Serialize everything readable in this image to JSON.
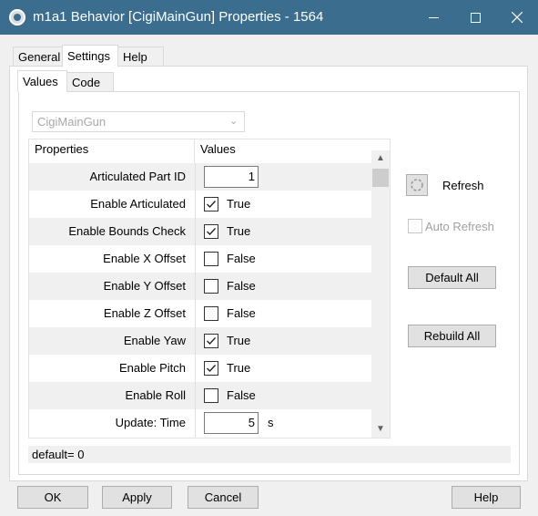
{
  "window": {
    "title": "m1a1 Behavior [CigiMainGun] Properties - 1564",
    "minimize_icon": "minimize-icon",
    "maximize_icon": "maximize-icon",
    "close_icon": "close-icon",
    "titlebar_color": "#3a6d8e"
  },
  "outer_tabs": [
    {
      "label": "General",
      "active": false
    },
    {
      "label": "Settings",
      "active": true
    },
    {
      "label": "Help",
      "active": false
    }
  ],
  "inner_tabs": [
    {
      "label": "Values",
      "active": true
    },
    {
      "label": "Code",
      "active": false
    }
  ],
  "component_select": {
    "value": "CigiMainGun",
    "disabled": true
  },
  "grid": {
    "col_properties": "Properties",
    "col_values": "Values",
    "rows": [
      {
        "name": "Articulated Part ID",
        "type": "number",
        "value": "1",
        "unit": ""
      },
      {
        "name": "Enable Articulated",
        "type": "bool",
        "checked": true,
        "value": "True"
      },
      {
        "name": "Enable Bounds Check",
        "type": "bool",
        "checked": true,
        "value": "True"
      },
      {
        "name": "Enable X Offset",
        "type": "bool",
        "checked": false,
        "value": "False"
      },
      {
        "name": "Enable Y Offset",
        "type": "bool",
        "checked": false,
        "value": "False"
      },
      {
        "name": "Enable Z Offset",
        "type": "bool",
        "checked": false,
        "value": "False"
      },
      {
        "name": "Enable Yaw",
        "type": "bool",
        "checked": true,
        "value": "True"
      },
      {
        "name": "Enable Pitch",
        "type": "bool",
        "checked": true,
        "value": "True"
      },
      {
        "name": "Enable Roll",
        "type": "bool",
        "checked": false,
        "value": "False"
      },
      {
        "name": "Update: Time",
        "type": "number",
        "value": "5",
        "unit": "s"
      }
    ]
  },
  "status_text": "default= 0",
  "side": {
    "refresh_label": "Refresh",
    "auto_refresh_label": "Auto Refresh",
    "auto_refresh_checked": false,
    "default_all_label": "Default All",
    "rebuild_all_label": "Rebuild All"
  },
  "buttons": {
    "ok": "OK",
    "apply": "Apply",
    "cancel": "Cancel",
    "help": "Help"
  }
}
